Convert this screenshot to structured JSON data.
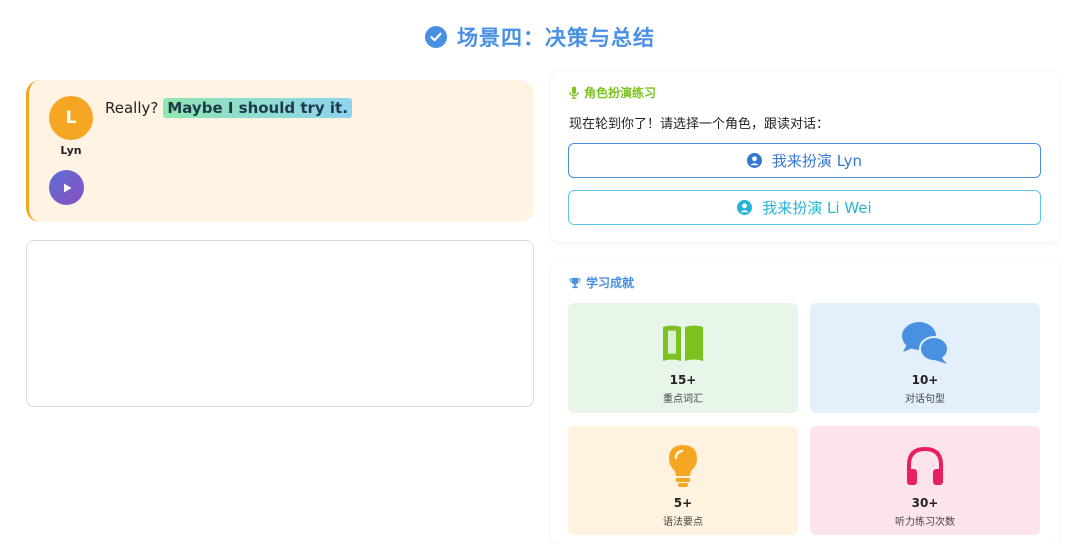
{
  "header": {
    "title": "场景四：决策与总结",
    "icon": "check-circle-icon",
    "color": "#4a90e2"
  },
  "dialogue": {
    "avatar_letter": "L",
    "speaker": "Lyn",
    "text_plain": "Really?",
    "text_highlight": "Maybe I should try it.",
    "play_icon": "play-icon",
    "accent": "#f5a623"
  },
  "roleplay": {
    "heading": "角色扮演练习",
    "heading_icon": "microphone-icon",
    "prompt": "现在轮到你了！请选择一个角色，跟读对话：",
    "options": [
      {
        "label": "我来扮演 Lyn",
        "icon": "user-circle-icon",
        "color": "#4a90e2"
      },
      {
        "label": "我来扮演 Li Wei",
        "icon": "user-circle-icon",
        "color": "#26b4d8"
      }
    ]
  },
  "achievements": {
    "heading": "学习成就",
    "heading_icon": "trophy-icon",
    "items": [
      {
        "value": "15+",
        "label": "重点词汇",
        "icon": "book-icon",
        "color": "#7cc322"
      },
      {
        "value": "10+",
        "label": "对话句型",
        "icon": "comments-icon",
        "color": "#4a90e2"
      },
      {
        "value": "5+",
        "label": "语法要点",
        "icon": "lightbulb-icon",
        "color": "#f5a623"
      },
      {
        "value": "30+",
        "label": "听力练习次数",
        "icon": "headphones-icon",
        "color": "#e91e63"
      }
    ]
  }
}
